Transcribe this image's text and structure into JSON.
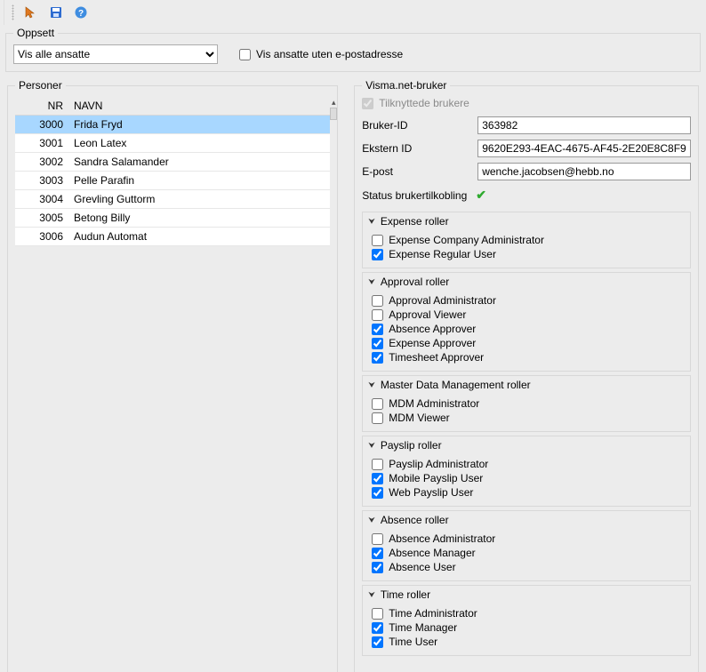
{
  "toolbar": {
    "icons": [
      "pointer-icon",
      "save-icon",
      "help-icon"
    ]
  },
  "oppsett": {
    "legend": "Oppsett",
    "filter_label": "Vis alle ansatte",
    "no_email_label": "Vis ansatte uten e-postadresse",
    "no_email_checked": false
  },
  "personer": {
    "legend": "Personer",
    "col_nr": "NR",
    "col_navn": "NAVN",
    "rows": [
      {
        "nr": "3000",
        "navn": "Frida Fryd",
        "selected": true
      },
      {
        "nr": "3001",
        "navn": "Leon Latex"
      },
      {
        "nr": "3002",
        "navn": "Sandra Salamander"
      },
      {
        "nr": "3003",
        "navn": "Pelle Parafin"
      },
      {
        "nr": "3004",
        "navn": "Grevling Guttorm"
      },
      {
        "nr": "3005",
        "navn": "Betong Billy"
      },
      {
        "nr": "3006",
        "navn": "Audun Automat"
      }
    ]
  },
  "bruker": {
    "legend": "Visma.net-bruker",
    "tilknyttede_label": "Tilknyttede brukere",
    "tilknyttede_checked": true,
    "bruker_id_label": "Bruker-ID",
    "bruker_id_value": "363982",
    "ekstern_id_label": "Ekstern ID",
    "ekstern_id_value": "9620E293-4EAC-4675-AF45-2E20E8C8F9",
    "epost_label": "E-post",
    "epost_value": "wenche.jacobsen@hebb.no",
    "status_label": "Status brukertilkobling"
  },
  "roles": [
    {
      "title": "Expense roller",
      "items": [
        {
          "label": "Expense Company Administrator",
          "checked": false
        },
        {
          "label": "Expense Regular User",
          "checked": true
        }
      ]
    },
    {
      "title": "Approval roller",
      "items": [
        {
          "label": "Approval Administrator",
          "checked": false
        },
        {
          "label": "Approval Viewer",
          "checked": false
        },
        {
          "label": "Absence Approver",
          "checked": true
        },
        {
          "label": "Expense Approver",
          "checked": true
        },
        {
          "label": "Timesheet Approver",
          "checked": true
        }
      ]
    },
    {
      "title": "Master Data Management roller",
      "items": [
        {
          "label": "MDM Administrator",
          "checked": false
        },
        {
          "label": "MDM Viewer",
          "checked": false
        }
      ]
    },
    {
      "title": "Payslip roller",
      "items": [
        {
          "label": "Payslip Administrator",
          "checked": false
        },
        {
          "label": "Mobile Payslip User",
          "checked": true
        },
        {
          "label": "Web Payslip User",
          "checked": true
        }
      ]
    },
    {
      "title": "Absence roller",
      "items": [
        {
          "label": "Absence Administrator",
          "checked": false
        },
        {
          "label": "Absence Manager",
          "checked": true
        },
        {
          "label": "Absence User",
          "checked": true
        }
      ]
    },
    {
      "title": "Time roller",
      "items": [
        {
          "label": "Time Administrator",
          "checked": false
        },
        {
          "label": "Time Manager",
          "checked": true
        },
        {
          "label": "Time User",
          "checked": true
        }
      ]
    }
  ]
}
